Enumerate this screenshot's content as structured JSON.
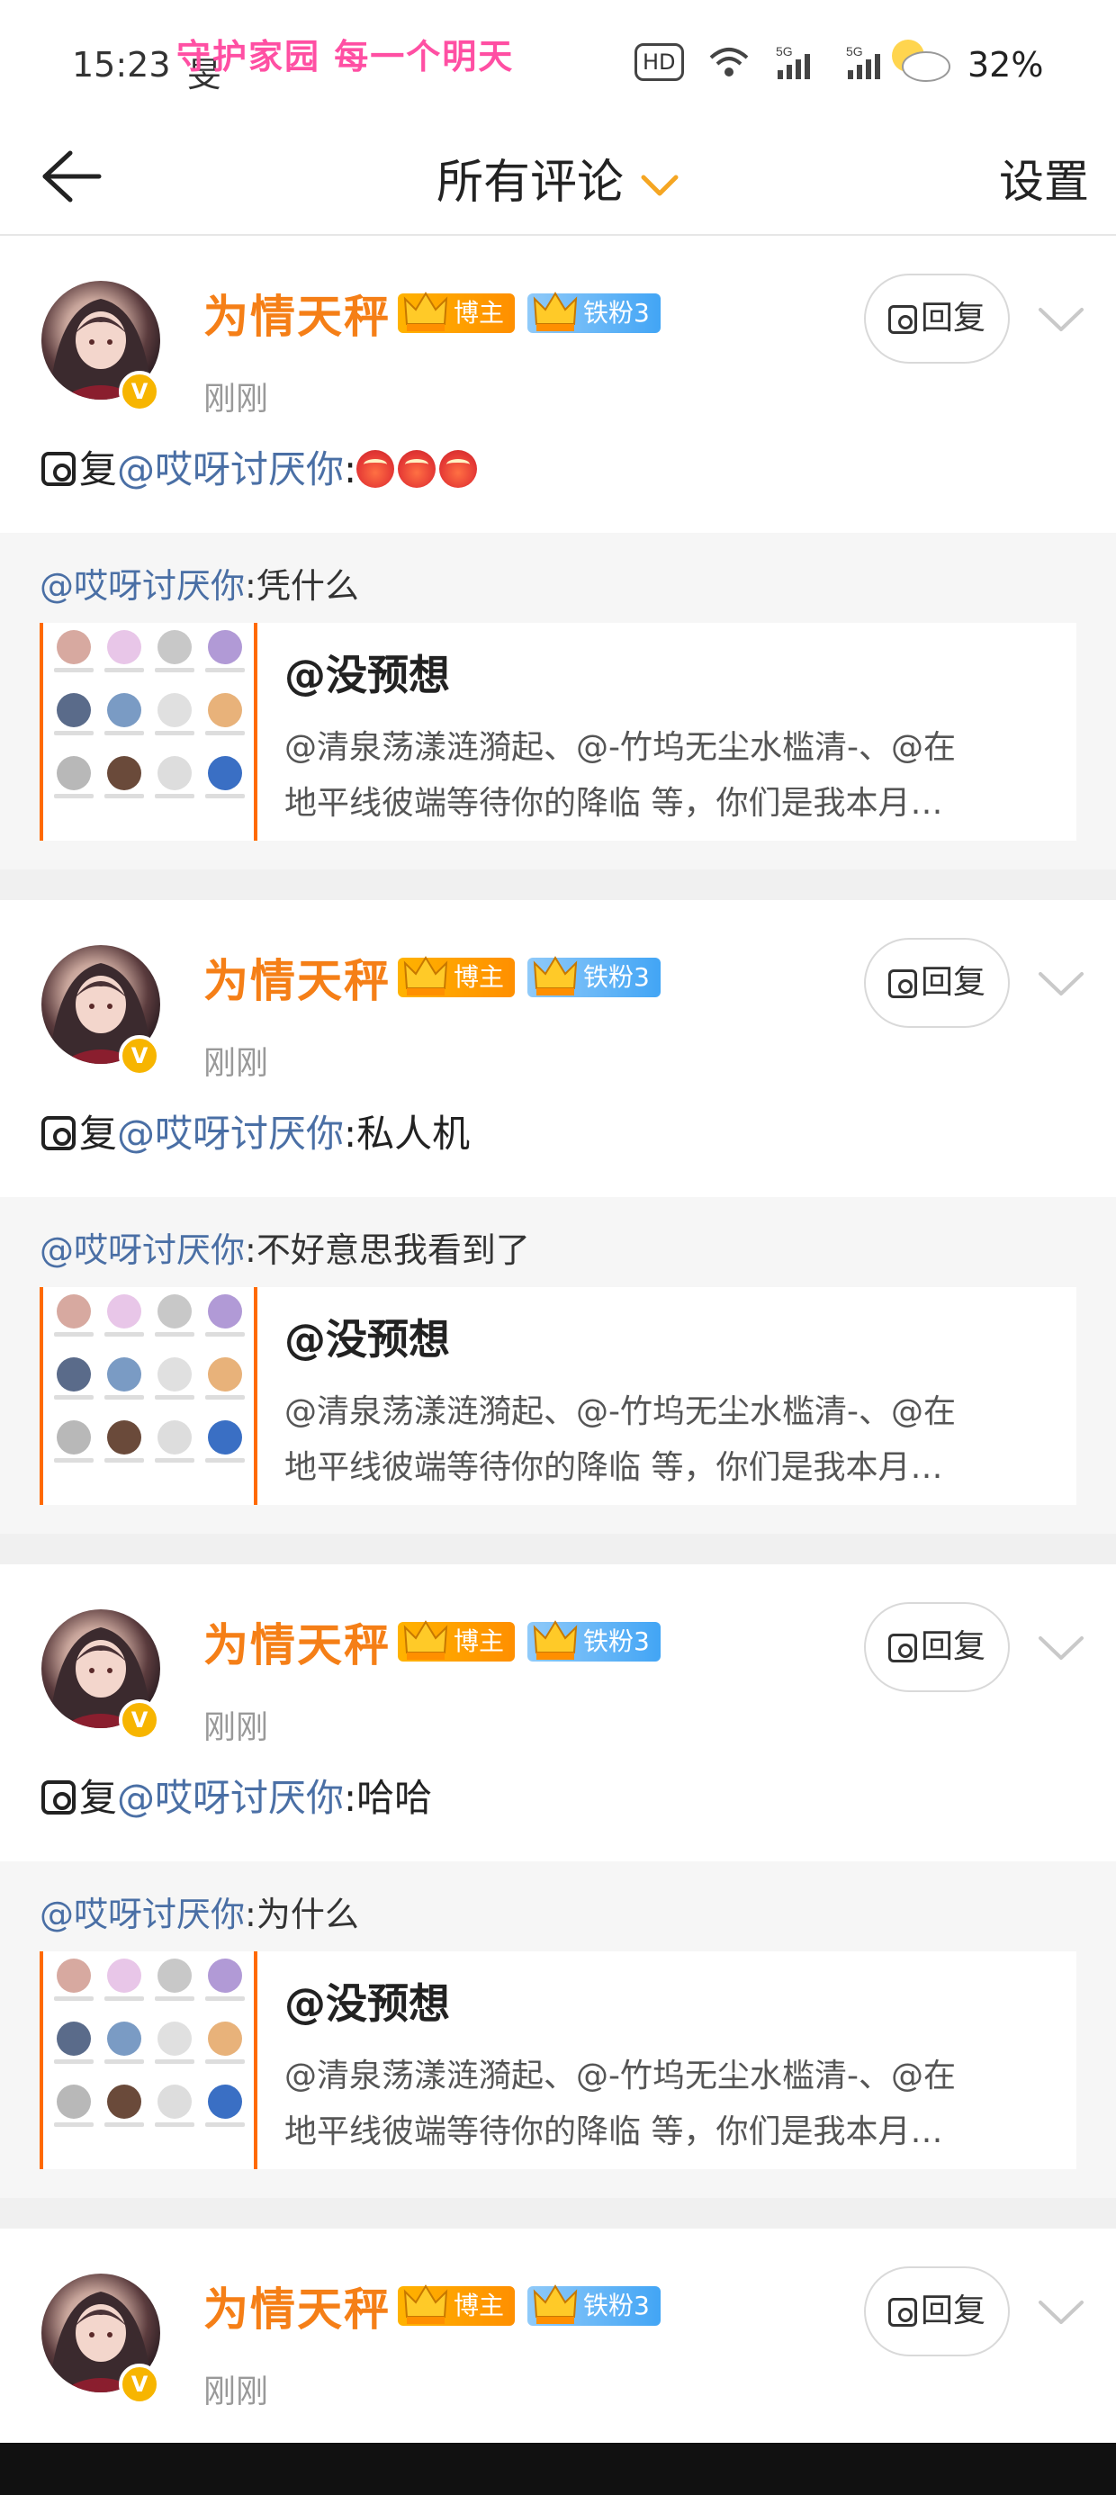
{
  "status_bar": {
    "time": "15:23",
    "slogan": "守护家园 每一个明天",
    "stray": "旻",
    "hd": "HD",
    "sim1": "5G",
    "sim2": "5G",
    "battery": "32%"
  },
  "nav": {
    "title": "所有评论",
    "settings": "设置"
  },
  "comments": [
    {
      "username": "为情天秤",
      "badge_blogger": "博主",
      "badge_fan": "铁粉3",
      "time": "刚刚",
      "reply_label": "回复",
      "reply_prefix": "复",
      "mention": "@哎呀讨厌你",
      "text": ":",
      "quote_mention": "@哎呀讨厌你",
      "quote_text": ":凭什么",
      "share_title": "@没预想",
      "share_line1": "@清泉荡漾涟漪起、@-竹坞无尘水槛清-、@在",
      "share_line2": "地平线彼端等待你的降临 等，你们是我本月…"
    },
    {
      "username": "为情天秤",
      "badge_blogger": "博主",
      "badge_fan": "铁粉3",
      "time": "刚刚",
      "reply_label": "回复",
      "reply_prefix": "复",
      "mention": "@哎呀讨厌你",
      "text": ":私人机",
      "quote_mention": "@哎呀讨厌你",
      "quote_text": ":不好意思我看到了",
      "share_title": "@没预想",
      "share_line1": "@清泉荡漾涟漪起、@-竹坞无尘水槛清-、@在",
      "share_line2": "地平线彼端等待你的降临 等，你们是我本月…"
    },
    {
      "username": "为情天秤",
      "badge_blogger": "博主",
      "badge_fan": "铁粉3",
      "time": "刚刚",
      "reply_label": "回复",
      "reply_prefix": "复",
      "mention": "@哎呀讨厌你",
      "text": ":哈哈",
      "quote_mention": "@哎呀讨厌你",
      "quote_text": ":为什么",
      "share_title": "@没预想",
      "share_line1": "@清泉荡漾涟漪起、@-竹坞无尘水槛清-、@在",
      "share_line2": "地平线彼端等待你的降临 等，你们是我本月…"
    },
    {
      "username": "为情天秤",
      "badge_blogger": "博主",
      "badge_fan": "铁粉3",
      "time": "刚刚",
      "reply_label": "回复"
    }
  ],
  "colors": {
    "username": "#f57f17",
    "mention": "#4a6fa5",
    "slogan": "#ff4fa3"
  }
}
